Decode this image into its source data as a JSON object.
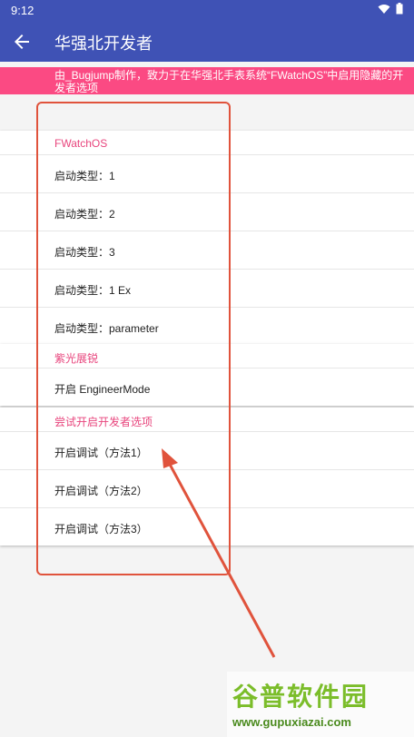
{
  "status": {
    "time": "9:12"
  },
  "appbar": {
    "title": "华强北开发者"
  },
  "banner": {
    "text": "由_Bugjump制作，致力于在华强北手表系统“FWatchOS”中启用隐藏的开发者选项"
  },
  "sections": [
    {
      "title": "FWatchOS",
      "items": [
        "启动类型：1",
        "启动类型：2",
        "启动类型：3",
        "启动类型：1 Ex",
        "启动类型：parameter"
      ]
    },
    {
      "title": "紫光展锐",
      "items": [
        "开启 EngineerMode"
      ]
    },
    {
      "title": "尝试开启开发者选项",
      "items": [
        "开启调试（方法1）",
        "开启调试（方法2）",
        "开启调试（方法3）"
      ]
    }
  ],
  "watermark": {
    "text": "谷普软件园",
    "url": "www.gupuxiazai.com"
  },
  "colors": {
    "primary": "#3f52b5",
    "accent": "#fb4a83",
    "annotation": "#e0533c"
  }
}
